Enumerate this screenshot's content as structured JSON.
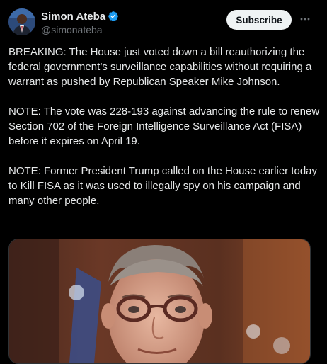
{
  "tweet": {
    "author": {
      "display_name": "Simon Ateba",
      "handle": "@simonateba",
      "verified": true,
      "verified_color": "#1d9bf0"
    },
    "subscribe_label": "Subscribe",
    "more_icon": "ellipsis-icon",
    "paragraphs": [
      "BREAKING: The House just voted down a bill reauthorizing the federal government’s surveillance capabilities without requiring a warrant as pushed by Republican Speaker Mike Johnson.",
      "NOTE: The vote was 228-193 against advancing the rule to renew Section 702 of the Foreign Intelligence Surveillance Act (FISA) before it expires on April 19.",
      "NOTE: Former President Trump called on the House earlier today to Kill FISA as it was used to illegally spy on his campaign and many other people."
    ],
    "media": {
      "kind": "photo"
    }
  }
}
